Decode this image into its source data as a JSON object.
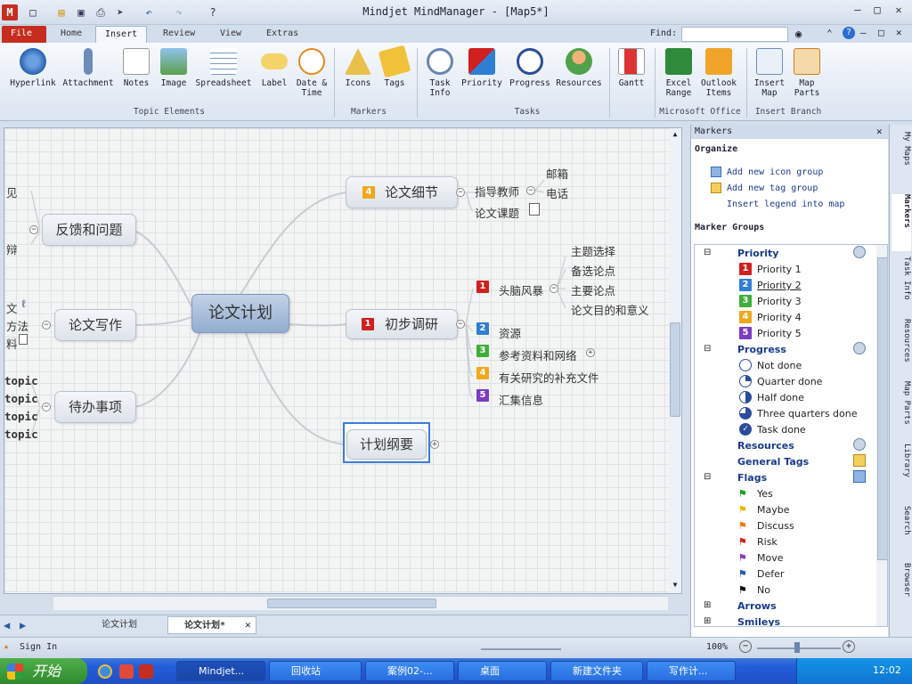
{
  "window": {
    "title": "Mindjet MindManager - [Map5*]"
  },
  "tabs": [
    "File",
    "Home",
    "Insert",
    "Review",
    "View",
    "Extras"
  ],
  "find_label": "Find:",
  "ribbon": {
    "buttons": [
      "Hyperlink",
      "Attachment",
      "Notes",
      "Image",
      "Spreadsheet",
      "Label",
      "Date &\nTime",
      "Icons",
      "Tags",
      "Task\nInfo",
      "Priority",
      "Progress",
      "Resources",
      "Gantt",
      "Excel\nRange",
      "Outlook\nItems",
      "Insert\nMap",
      "Map\nParts"
    ],
    "groups": [
      "Topic Elements",
      "Markers",
      "Tasks",
      "Microsoft Office",
      "Insert Branch"
    ]
  },
  "map": {
    "central": "论文计划",
    "left_topics": [
      "反馈和问题",
      "论文写作",
      "待办事项"
    ],
    "left_fragments": [
      "见",
      "辩",
      "文",
      "方法",
      "料",
      "topic",
      "topic",
      "topic",
      "topic"
    ],
    "topic_detail": {
      "label": "论文细节",
      "priority": "4"
    },
    "detail_children": [
      "指导教师",
      "论文课题"
    ],
    "teacher_children": [
      "邮箱",
      "电话"
    ],
    "topic_research": {
      "label": "初步调研",
      "priority": "1"
    },
    "brainstorm": {
      "label": "头脑风暴",
      "priority": "1"
    },
    "brainstorm_children": [
      "主题选择",
      "备选论点",
      "主要论点",
      "论文目的和意义"
    ],
    "research_children": [
      {
        "label": "资源",
        "priority": "2"
      },
      {
        "label": "参考资料和网络",
        "priority": "3"
      },
      {
        "label": "有关研究的补充文件",
        "priority": "4"
      },
      {
        "label": "汇集信息",
        "priority": "5"
      }
    ],
    "selected_topic": "计划纲要"
  },
  "doc_tabs": [
    "论文计划",
    "论文计划*"
  ],
  "status": {
    "sign_in": "Sign In",
    "zoom": "100%"
  },
  "panel": {
    "title": "Markers",
    "organize": "Organize",
    "links": [
      "Add new icon group",
      "Add new tag group",
      "Insert legend into map"
    ],
    "marker_groups": "Marker Groups",
    "priority": {
      "name": "Priority",
      "items": [
        "Priority 1",
        "Priority 2",
        "Priority 3",
        "Priority 4",
        "Priority 5"
      ]
    },
    "progress": {
      "name": "Progress",
      "items": [
        "Not done",
        "Quarter done",
        "Half done",
        "Three quarters done",
        "Task done"
      ]
    },
    "resources": "Resources",
    "general_tags": "General Tags",
    "flags": {
      "name": "Flags",
      "items": [
        "Yes",
        "Maybe",
        "Discuss",
        "Risk",
        "Move",
        "Defer",
        "No"
      ]
    },
    "arrows": "Arrows",
    "smileys": "Smileys"
  },
  "side_tabs": [
    "My Maps",
    "Markers",
    "Task Info",
    "Resources",
    "Map Parts",
    "Library",
    "Search",
    "Browser"
  ],
  "taskbar": {
    "start": "开始",
    "items": [
      "Mindjet...",
      "回收站",
      "案例02-...",
      "桌面",
      "新建文件夹",
      "写作计..."
    ],
    "clock": "12:02"
  },
  "colors": {
    "priority": [
      "#d21f1f",
      "#2e7fd4",
      "#3fae3a",
      "#f0a81c",
      "#7a3cc0"
    ],
    "flags": [
      "#19a319",
      "#f0b400",
      "#ef7a14",
      "#d61f1f",
      "#8a3cc8",
      "#1c58b8",
      "#111111"
    ]
  }
}
